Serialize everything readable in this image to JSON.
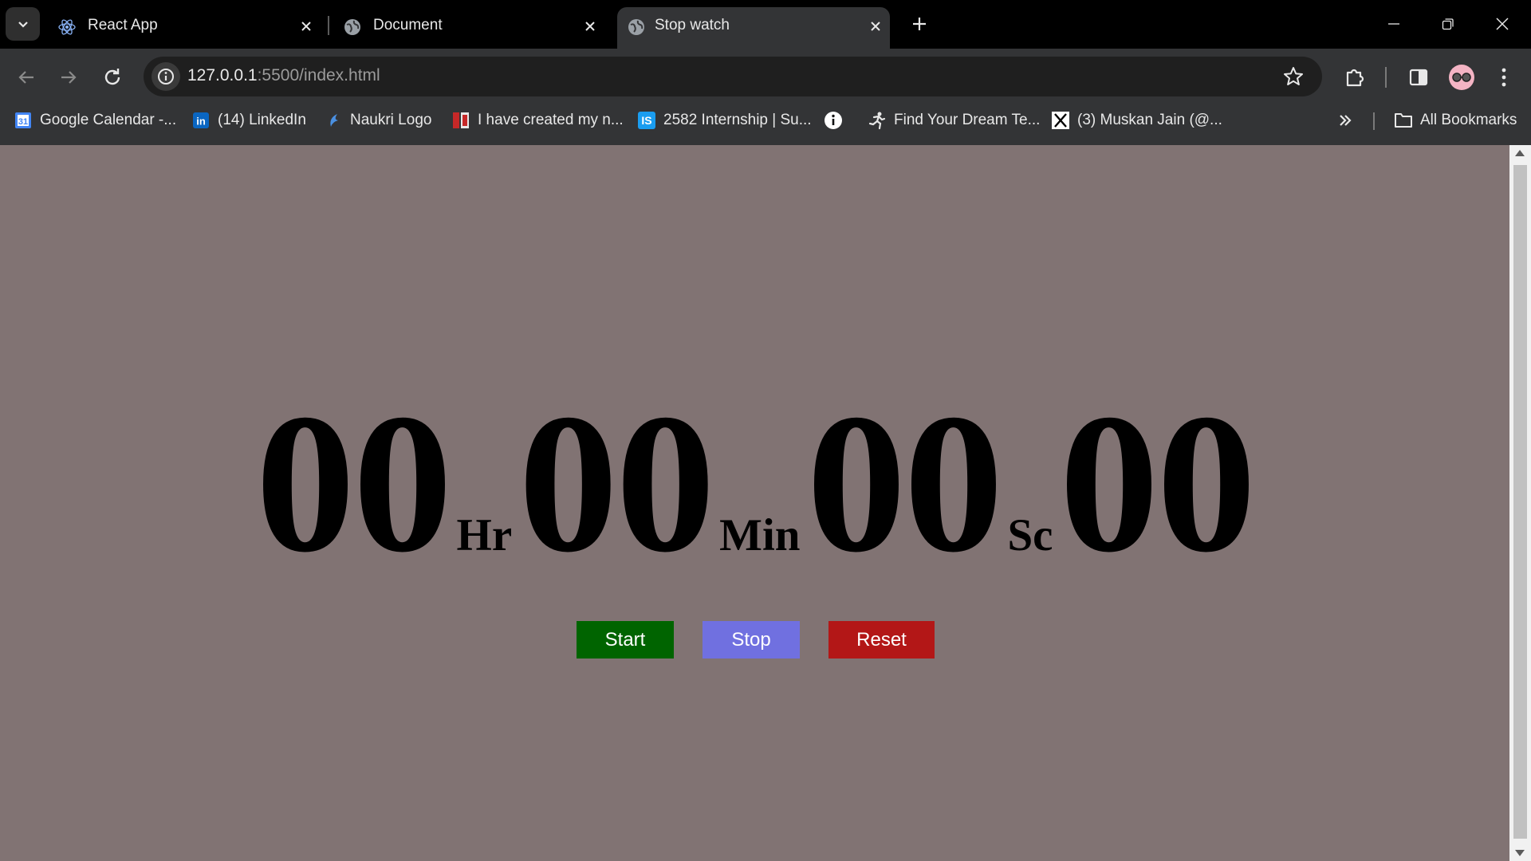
{
  "browser": {
    "tabs": [
      {
        "title": "React App",
        "icon": "react-icon",
        "active": false
      },
      {
        "title": "Document",
        "icon": "globe-icon",
        "active": false
      },
      {
        "title": "Stop watch",
        "icon": "globe-icon",
        "active": true
      }
    ],
    "url_host": "127.0.0.1",
    "url_rest": ":5500/index.html",
    "bookmarks": [
      {
        "label": "Google Calendar -...",
        "icon": "google-calendar-icon"
      },
      {
        "label": "(14) LinkedIn",
        "icon": "linkedin-icon"
      },
      {
        "label": "Naukri Logo",
        "icon": "naukri-icon"
      },
      {
        "label": "I have created my n...",
        "icon": "bookmark-site-icon"
      },
      {
        "label": "2582 Internship | Su...",
        "icon": "internshala-icon"
      },
      {
        "label": "",
        "icon": "info-icon"
      },
      {
        "label": "Find Your Dream Te...",
        "icon": "runner-icon"
      },
      {
        "label": "(3) Muskan Jain (@...",
        "icon": "x-icon"
      }
    ],
    "all_bookmarks_label": "All Bookmarks"
  },
  "stopwatch": {
    "hours": "00",
    "hours_unit": "Hr",
    "minutes": "00",
    "minutes_unit": "Min",
    "seconds": "00",
    "seconds_unit": "Sc",
    "centiseconds": "00",
    "buttons": {
      "start": "Start",
      "stop": "Stop",
      "reset": "Reset"
    }
  },
  "colors": {
    "page_background": "#817373",
    "start_button": "#006400",
    "stop_button": "#7070e0",
    "reset_button": "#b31717"
  }
}
